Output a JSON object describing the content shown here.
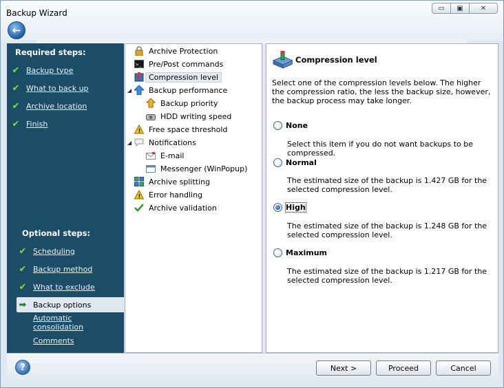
{
  "window": {
    "title": "Backup Wizard",
    "min_glyph": "▭",
    "max_glyph": "▣",
    "close_glyph": "✕"
  },
  "nav": {
    "required_title": "Required steps:",
    "required": [
      {
        "label": "Backup type"
      },
      {
        "label": "What to back up"
      },
      {
        "label": "Archive location"
      },
      {
        "label": "Finish"
      }
    ],
    "optional_title": "Optional steps:",
    "optional": [
      {
        "label": "Scheduling"
      },
      {
        "label": "Backup method"
      },
      {
        "label": "What to exclude"
      },
      {
        "label": "Backup options"
      },
      {
        "label": "Automatic consolidation"
      },
      {
        "label": "Comments"
      }
    ]
  },
  "tree": [
    {
      "label": "Archive Protection",
      "icon": "lock-icon"
    },
    {
      "label": "Pre/Post commands",
      "icon": "console-icon"
    },
    {
      "label": "Compression level",
      "icon": "compression-icon"
    },
    {
      "label": "Backup performance",
      "icon": "up-arrow-icon"
    },
    {
      "label": "Backup priority",
      "icon": "priority-icon"
    },
    {
      "label": "HDD writing speed",
      "icon": "hdd-icon"
    },
    {
      "label": "Free space threshold",
      "icon": "warning-icon"
    },
    {
      "label": "Notifications",
      "icon": "speech-bubble-icon"
    },
    {
      "label": "E-mail",
      "icon": "envelope-icon"
    },
    {
      "label": "Messenger (WinPopup)",
      "icon": "window-icon"
    },
    {
      "label": "Archive splitting",
      "icon": "split-icon"
    },
    {
      "label": "Error handling",
      "icon": "warning-icon"
    },
    {
      "label": "Archive validation",
      "icon": "checkmark-icon"
    }
  ],
  "panel": {
    "title": "Compression level",
    "description": "Select one of the compression levels below. The higher the compression ratio, the less the backup size, however, the backup process may take longer.",
    "options": [
      {
        "label": "None",
        "selected": false,
        "description": "Select this item if you do not want backups to be compressed."
      },
      {
        "label": "Normal",
        "selected": false,
        "description": "The estimated size of the backup is 1.427 GB for the selected compression level."
      },
      {
        "label": "High",
        "selected": true,
        "description": "The estimated size of the backup is 1.248 GB for the selected compression level."
      },
      {
        "label": "Maximum",
        "selected": false,
        "description": "The estimated size of the backup is 1.217 GB for the selected compression level."
      }
    ]
  },
  "footer": {
    "help": "?",
    "next": "Next >",
    "proceed": "Proceed",
    "cancel": "Cancel"
  },
  "colors": {
    "nav_bg": "#1b4d66",
    "check": "#7fe03a"
  }
}
